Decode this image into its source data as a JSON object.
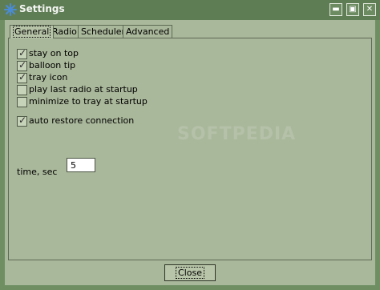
{
  "window": {
    "title": "Settings",
    "controls": {
      "minimize": "▬",
      "maximize": "▣",
      "close": "✕"
    }
  },
  "tabs": [
    {
      "label": "General"
    },
    {
      "label": "Radio"
    },
    {
      "label": "Scheduler"
    },
    {
      "label": "Advanced"
    }
  ],
  "settings": {
    "options": [
      {
        "label": "stay on top",
        "checked": true
      },
      {
        "label": "balloon tip",
        "checked": true
      },
      {
        "label": "tray icon",
        "checked": true
      },
      {
        "label": "play last radio at startup",
        "checked": false
      },
      {
        "label": "minimize to tray at startup",
        "checked": false
      },
      {
        "label": "auto restore connection",
        "checked": true
      }
    ],
    "time": {
      "label": "time, sec",
      "value": "5"
    }
  },
  "footer": {
    "close_label": "Close"
  },
  "watermark": "SOFTPEDIA",
  "colors": {
    "window_bg": "#6f8f63",
    "client_bg": "#a9b79a",
    "titlebar_bg": "#5f7d55",
    "input_bg": "#ffffff"
  },
  "icons": {
    "app": "snowflake-icon"
  }
}
